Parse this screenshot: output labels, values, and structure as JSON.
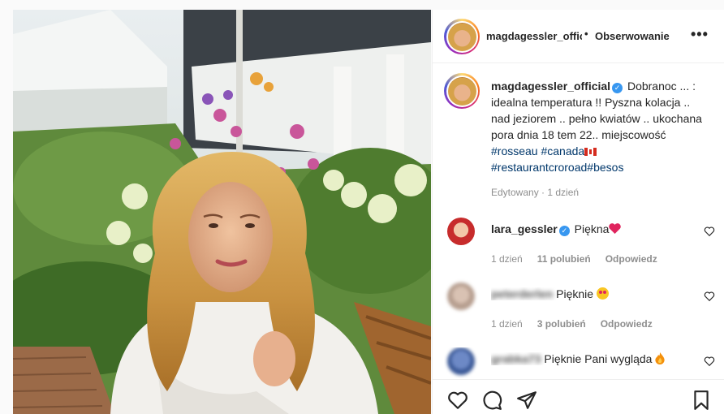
{
  "header": {
    "username": "magdagessler_official",
    "separator": "•",
    "follow_label": "Obserwowanie",
    "more_label": "•••"
  },
  "caption": {
    "username": "magdagessler_official",
    "text": "Dobranoc ... : idealna temperatura !! Pyszna kolacja .. nad jeziorem .. pełno kwiatów .. ukochana pora dnia 18 tem 22.. miejscowość",
    "tags": [
      "#rosseau",
      "#canada",
      "#restaurantcroroad",
      "#besos"
    ],
    "meta": "Edytowany · 1 dzień"
  },
  "comments": [
    {
      "username": "lara_gessler",
      "text": "Piękna",
      "time": "1 dzień",
      "likes": "11 polubień",
      "reply": "Odpowiedz"
    },
    {
      "username": "peterderlen",
      "text": "Pięknie",
      "time": "1 dzień",
      "likes": "3 polubień",
      "reply": "Odpowiedz"
    },
    {
      "username": "grabka73",
      "text": "Pięknie Pani wygląda"
    }
  ],
  "icons": {
    "verified": "verified-badge-icon",
    "like": "heart-outline-icon",
    "comment": "comment-bubble-icon",
    "share": "paper-plane-icon",
    "save": "bookmark-icon"
  },
  "colors": {
    "verified": "#3897f0",
    "hashtag": "#00376b",
    "muted": "#8e8e8e"
  }
}
